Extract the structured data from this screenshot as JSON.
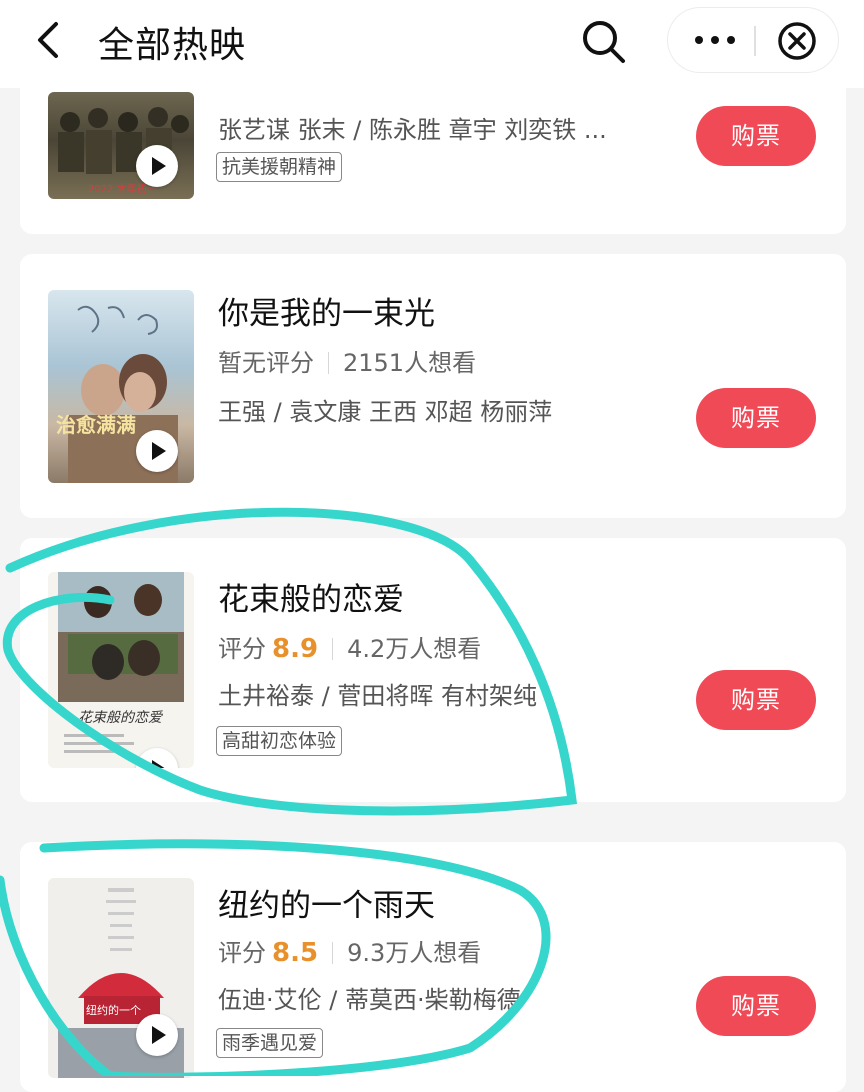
{
  "header": {
    "title": "全部热映"
  },
  "movies": [
    {
      "title": "",
      "cast": "张艺谋 张末 / 陈永胜 章宇 刘奕铁 ...",
      "tag": "抗美援朝精神",
      "buy_label": "购票",
      "poster_text": "2022 大年初一"
    },
    {
      "title": "你是我的一束光",
      "rating_label": "暂无评分",
      "want_count": "2151人想看",
      "cast": "王强 / 袁文康 王西 邓超 杨丽萍",
      "buy_label": "购票"
    },
    {
      "title": "花束般的恋爱",
      "rating_label": "评分",
      "score": "8.9",
      "want_count": "4.2万人想看",
      "cast": "土井裕泰 / 菅田将晖 有村架纯",
      "tag": "高甜初恋体验",
      "buy_label": "购票"
    },
    {
      "title": "纽约的一个雨天",
      "rating_label": "评分",
      "score": "8.5",
      "want_count": "9.3万人想看",
      "cast": "伍迪·艾伦 / 蒂莫西·柴勒梅德",
      "tag": "雨季遇见爱",
      "buy_label": "购票"
    }
  ],
  "colors": {
    "buy_button": "#f04a57",
    "score": "#e8912b",
    "annotation": "#37d6cc"
  }
}
